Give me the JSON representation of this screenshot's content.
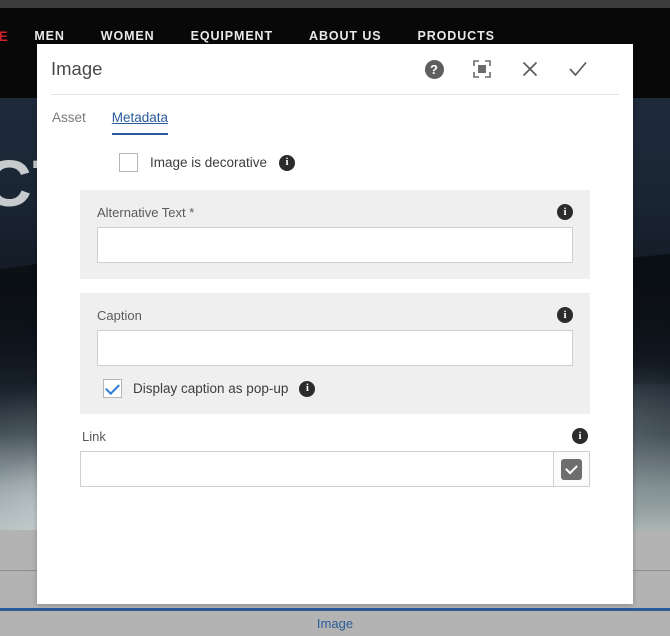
{
  "background": {
    "nav": {
      "brand_fragment": "ICE",
      "links": [
        "MEN",
        "WOMEN",
        "EQUIPMENT",
        "ABOUT US",
        "PRODUCTS"
      ]
    },
    "hero_text_fragment": "CT",
    "bottom_bar": {
      "label": "Image"
    }
  },
  "dialog": {
    "title": "Image",
    "actions": [
      {
        "name": "help-icon",
        "glyph": "?"
      },
      {
        "name": "fullscreen-icon",
        "glyph": ""
      },
      {
        "name": "close-icon",
        "glyph": "✕"
      },
      {
        "name": "confirm-icon",
        "glyph": "✓"
      }
    ],
    "tabs": [
      {
        "label": "Asset",
        "active": false
      },
      {
        "label": "Metadata",
        "active": true
      }
    ],
    "decorative": {
      "label": "Image is decorative",
      "checked": false,
      "info": "i"
    },
    "alt_text": {
      "label": "Alternative Text *",
      "value": "",
      "placeholder": "",
      "info": "i"
    },
    "caption": {
      "label": "Caption",
      "value": "",
      "placeholder": "",
      "info": "i",
      "popup": {
        "label": "Display caption as pop-up",
        "checked": true,
        "info": "i"
      }
    },
    "link": {
      "label": "Link",
      "value": "",
      "placeholder": "",
      "info": "i",
      "picker_button": "select-link"
    }
  },
  "colors": {
    "accent_blue": "#2a5b99",
    "check_blue": "#2f7bd4",
    "brand_red": "#d0202a",
    "panel_gray": "#efefef"
  }
}
